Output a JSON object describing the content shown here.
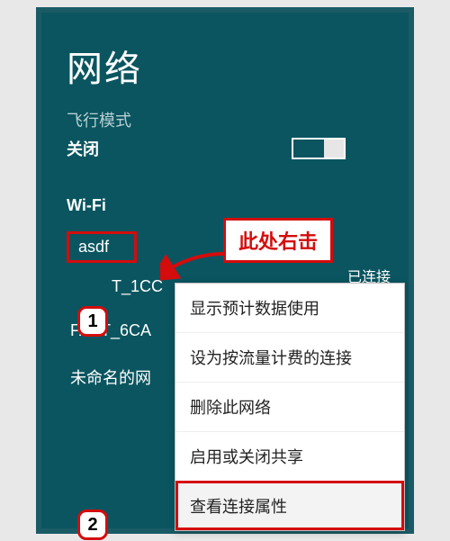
{
  "panel": {
    "title": "网络",
    "airplane_label": "飞行模式",
    "airplane_state": "关闭",
    "wifi_heading": "Wi-Fi",
    "status": "已连接",
    "networks": {
      "selected": "asdf",
      "item1": "T_1CC",
      "item2": "FAST_6CA",
      "item3": "未命名的网"
    }
  },
  "menu": {
    "items": [
      "显示预计数据使用",
      "设为按流量计费的连接",
      "删除此网络",
      "启用或关闭共享",
      "查看连接属性"
    ]
  },
  "annotations": {
    "callout": "此处右击",
    "badge1": "1",
    "badge2": "2"
  }
}
